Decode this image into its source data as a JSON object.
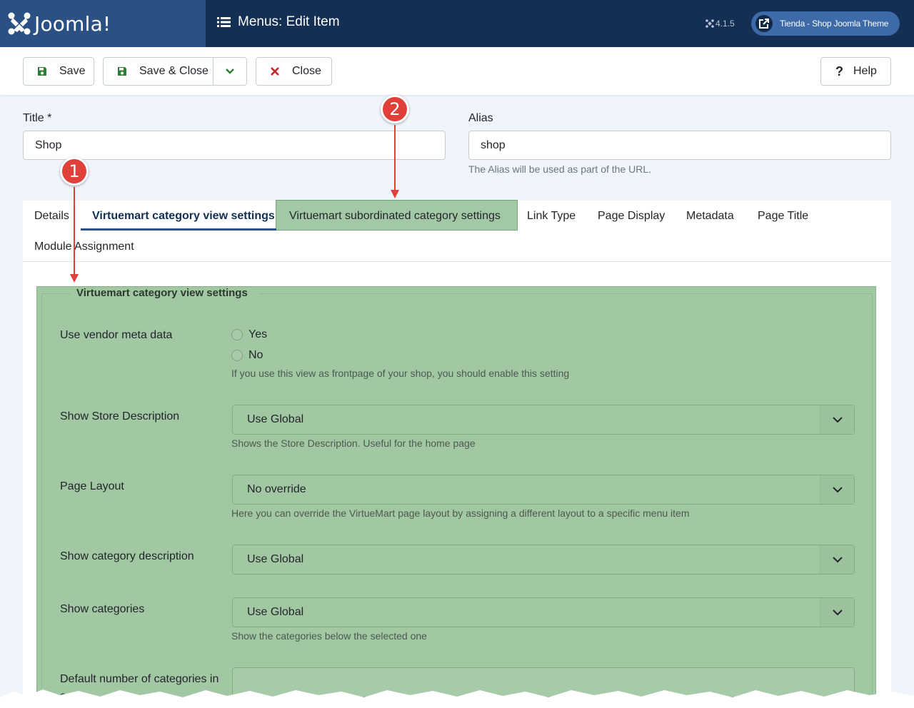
{
  "header": {
    "logo_text": "Joomla!",
    "page_title": "Menus: Edit Item",
    "version": "4.1.5",
    "site_link": "Tienda - Shop Joomla Theme"
  },
  "toolbar": {
    "save_label": "Save",
    "save_close_label": "Save & Close",
    "close_label": "Close",
    "help_label": "Help"
  },
  "form": {
    "title_label": "Title *",
    "title_value": "Shop",
    "alias_label": "Alias",
    "alias_value": "shop",
    "alias_hint": "The Alias will be used as part of the URL."
  },
  "tabs": [
    {
      "label": "Details"
    },
    {
      "label": "Virtuemart category view settings"
    },
    {
      "label": "Virtuemart subordinated category settings"
    },
    {
      "label": "Link Type"
    },
    {
      "label": "Page Display"
    },
    {
      "label": "Metadata"
    },
    {
      "label": "Page Title"
    },
    {
      "label": "Module Assignment"
    }
  ],
  "fieldset": {
    "legend": "Virtuemart category view settings",
    "vendor_meta": {
      "label": "Use vendor meta data",
      "options": [
        "Yes",
        "No"
      ],
      "desc": "If you use this view as frontpage of your shop, you should enable this setting"
    },
    "store_desc": {
      "label": "Show Store Description",
      "value": "Use Global",
      "desc": "Shows the Store Description. Useful for the home page"
    },
    "page_layout": {
      "label": "Page Layout",
      "value": "No override",
      "desc": "Here you can override the VirtueMart page layout by assigning a different layout to a specific menu item"
    },
    "cat_desc": {
      "label": "Show category description",
      "value": "Use Global"
    },
    "show_cats": {
      "label": "Show categories",
      "value": "Use Global",
      "desc": "Show the categories below the selected one"
    },
    "default_num": {
      "label": "Default number of categories in a row"
    }
  },
  "annotations": {
    "badge1": "1",
    "badge2": "2",
    "color": "#e0403a"
  }
}
